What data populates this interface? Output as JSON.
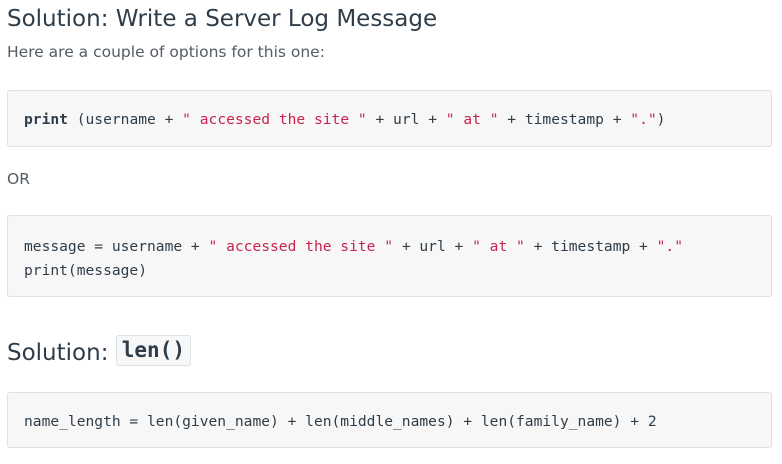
{
  "section1": {
    "title": "Solution: Write a Server Log Message",
    "intro": "Here are a couple of options for this one:",
    "code1": {
      "kw_print": "print",
      "t1": " (username + ",
      "s1": "\" accessed the site \"",
      "t2": " + url + ",
      "s2": "\" at \"",
      "t3": " + timestamp + ",
      "s3": "\".\"",
      "t4": ")"
    },
    "or_label": "OR",
    "code2": {
      "l1_t1": "message = username + ",
      "l1_s1": "\" accessed the site \"",
      "l1_t2": " + url + ",
      "l1_s2": "\" at \"",
      "l1_t3": " + timestamp + ",
      "l1_s3": "\".\"",
      "l2": "print(message)"
    }
  },
  "section2": {
    "title_prefix": "Solution: ",
    "title_code": "len()",
    "code": "name_length = len(given_name) + len(middle_names) + len(family_name) + 2"
  },
  "colors": {
    "heading": "#2e3d49",
    "string": "#c7254e",
    "code_bg": "#f7f7f7",
    "code_border": "#dbe2e8"
  }
}
